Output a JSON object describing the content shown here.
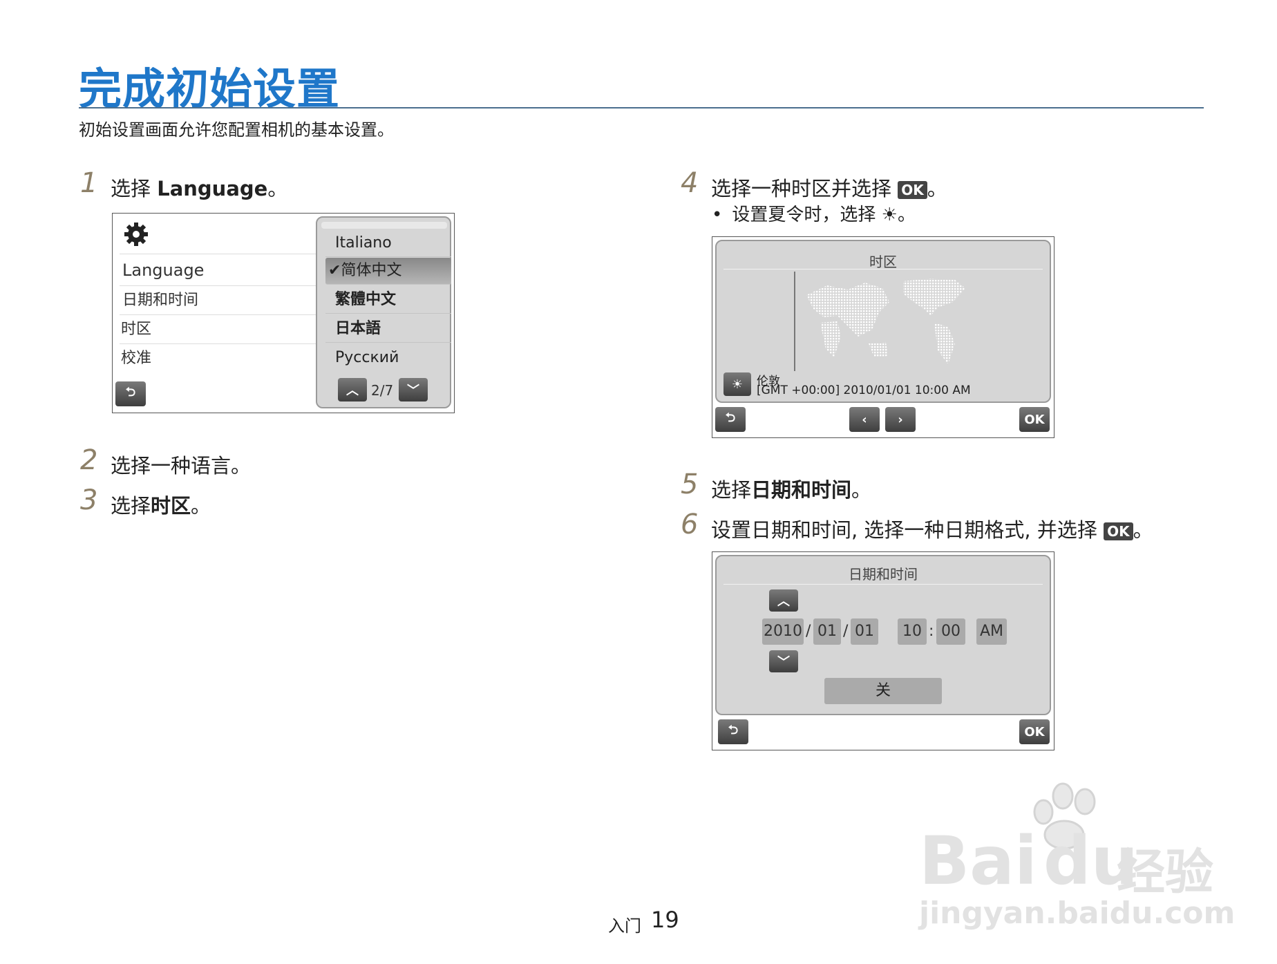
{
  "page": {
    "title": "完成初始设置",
    "subtitle": "初始设置画面允许您配置相机的基本设置。",
    "footer_section": "入门",
    "footer_page": "19"
  },
  "steps": [
    {
      "num": "1",
      "text_prefix": "选择 ",
      "text_bold": "Language",
      "text_suffix": "。"
    },
    {
      "num": "2",
      "text": "选择一种语言。"
    },
    {
      "num": "3",
      "text_prefix": "选择",
      "text_bold": "时区",
      "text_suffix": "。"
    },
    {
      "num": "4",
      "text_prefix": "选择一种时区并选择 ",
      "ok": "OK",
      "text_suffix": "。",
      "bullet": "设置夏令时，选择",
      "bullet_suffix": "。"
    },
    {
      "num": "5",
      "text_prefix": "选择",
      "text_bold": "日期和时间",
      "text_suffix": "。"
    },
    {
      "num": "6",
      "text_prefix": "设置日期和时间, 选择一种日期格式, 并选择 ",
      "ok": "OK",
      "text_suffix": "。"
    }
  ],
  "screen1": {
    "icon": "gear-icon",
    "menu": [
      "Language",
      "日期和时间",
      "时区",
      "校准"
    ],
    "languages": [
      "Italiano",
      "简体中文",
      "繁體中文",
      "日本語",
      "Русский"
    ],
    "selected_language": "简体中文",
    "page_indicator": "2/7",
    "check": "✔"
  },
  "screen2": {
    "title": "时区",
    "city": "伦敦",
    "gmt_info": "[GMT +00:00] 2010/01/01 10:00 AM",
    "ok_label": "OK"
  },
  "screen3": {
    "title": "日期和时间",
    "year": "2010",
    "month": "01",
    "day": "01",
    "hour": "10",
    "minute": "00",
    "ampm": "AM",
    "date_sep": "/",
    "time_sep": ":",
    "dst": "关",
    "ok_label": "OK"
  },
  "watermark": {
    "brand_left": "Bai",
    "brand_right": "du",
    "brand_cn": "经验",
    "url": "jingyan.baidu.com"
  }
}
